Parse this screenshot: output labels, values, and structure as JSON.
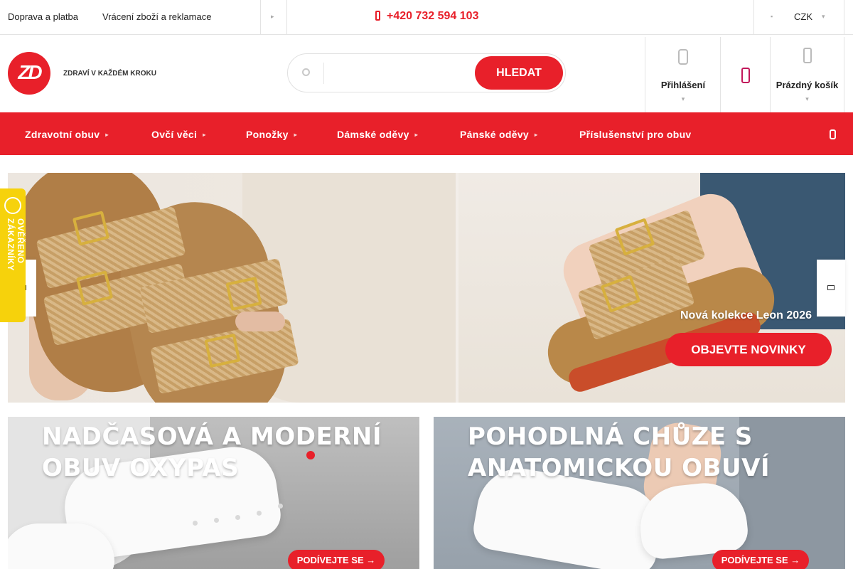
{
  "topbar": {
    "links": [
      "Doprava a platba",
      "Vrácení zboží a reklamace"
    ],
    "phone": "+420 732 594 103",
    "currency": "CZK"
  },
  "header": {
    "logo_text": "ZD",
    "tagline": "ZDRAVÍ V KAŽDÉM KROKU",
    "search": {
      "button": "HLEDAT",
      "value": ""
    },
    "login_label": "Přihlášení",
    "cart_label": "Prázdný košík"
  },
  "nav": {
    "items": [
      "Zdravotní obuv",
      "Ovčí věci",
      "Ponožky",
      "Dámské oděvy",
      "Pánské oděvy",
      "Příslušenství pro obuv"
    ]
  },
  "hero": {
    "promo": "Nová kolekce Leon 2026",
    "cta": "OBJEVTE NOVINKY"
  },
  "badge": {
    "text": "OVĚŘENO ZÁKAZNÍKY"
  },
  "banners": [
    {
      "line1": "NADČASOVÁ A MODERNÍ",
      "line2": "OBUV OXYPAS",
      "cta": "PODÍVEJTE SE"
    },
    {
      "line1": "POHODLNÁ CHŮZE S",
      "line2": "ANATOMICKOU OBUVÍ",
      "cta": "PODÍVEJTE SE"
    }
  ],
  "colors": {
    "brand": "#e8202a",
    "badge": "#f6d20c"
  },
  "icons": [
    "phone-icon",
    "search-icon",
    "user-icon",
    "heart-icon",
    "cart-icon",
    "chevron-down-icon",
    "chevron-left-icon",
    "chevron-right-icon"
  ]
}
